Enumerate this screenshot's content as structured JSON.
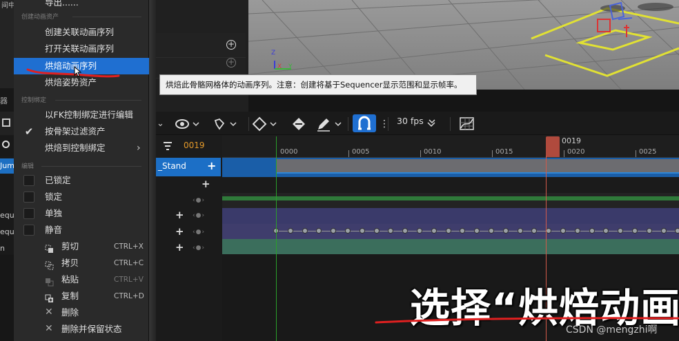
{
  "left_panel": {
    "top_text": "间中的",
    "tab_label": "器",
    "rows": [
      "Jum",
      "equ",
      "equ",
      "n"
    ]
  },
  "tooltip": "烘焙此骨骼网格体的动画序列。注意：创建将基于Sequencer显示范围和显示帧率。",
  "context_menu": {
    "export_item": "导出......",
    "section_create": "创建动画资产",
    "create_linked": "创建关联动画序列",
    "open_linked": "打开关联动画序列",
    "bake_anim": "烘焙动画序列",
    "bake_pose": "烘焙姿势资产",
    "section_control": "控制绑定",
    "fk_edit": "以FK控制绑定进行编辑",
    "filter_skeleton": "按骨架过滤资产",
    "bake_to_control": "烘焙到控制绑定",
    "section_edit": "编辑",
    "locked": "已锁定",
    "lock": "锁定",
    "solo": "单独",
    "mute": "静音",
    "cut": "剪切",
    "cut_sc": "CTRL+X",
    "copy": "拷贝",
    "copy_sc": "CTRL+C",
    "paste": "粘贴",
    "paste_sc": "CTRL+V",
    "duplicate": "复制",
    "duplicate_sc": "CTRL+D",
    "delete": "删除",
    "delete_keep": "删除并保留状态"
  },
  "toolbar": {
    "fps": "30 fps",
    "current_frame": "0019"
  },
  "tracks": {
    "stand_label": "_Stand"
  },
  "ruler": {
    "labels": [
      "0000",
      "0005",
      "0010",
      "0015",
      "0020",
      "0025"
    ],
    "playhead": "0019"
  },
  "viewport": {
    "axis_x": "X",
    "axis_y": "Y",
    "axis_z": "Z"
  },
  "caption": "选择“烘焙动画",
  "watermark": "CSDN @mengzhi啊",
  "colors": {
    "accent": "#1f6fd1",
    "playhead": "#d35a4b",
    "frame_text": "#e59a2a",
    "highlight_red": "#e02020"
  }
}
